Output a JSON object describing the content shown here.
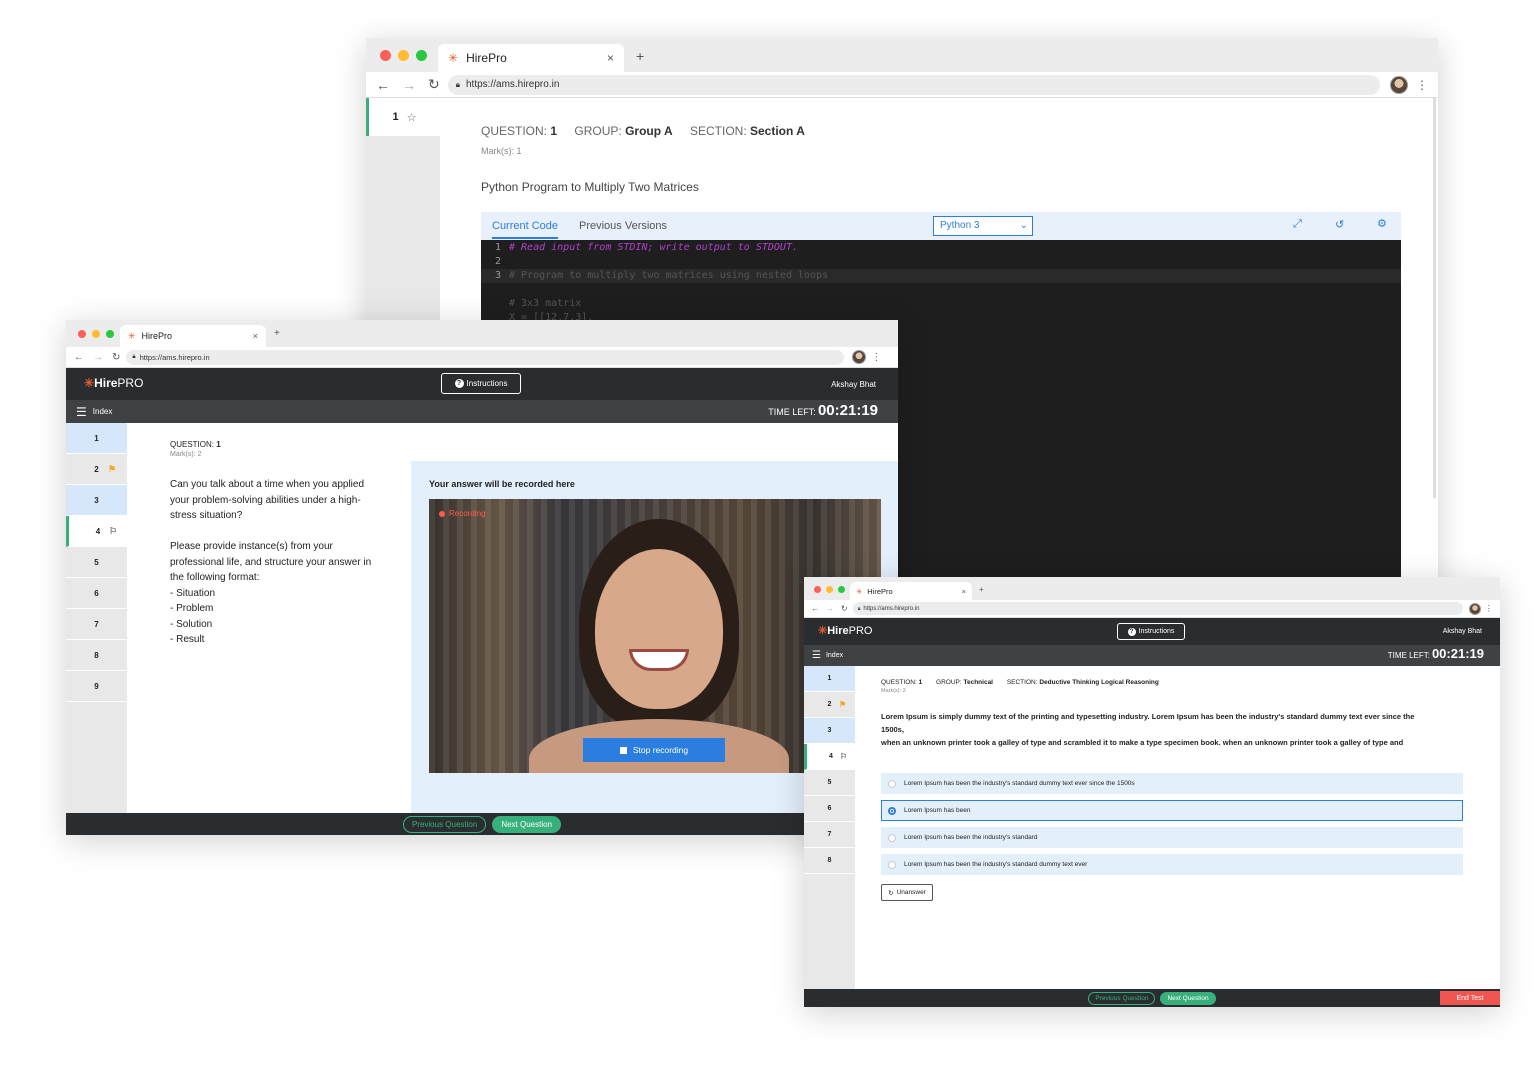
{
  "browser": {
    "tab_title": "HirePro",
    "url": "https://ams.hirepro.in",
    "new_tab": "+",
    "close": "×"
  },
  "back": {
    "sidebar_item": "1",
    "question_label": "QUESTION:",
    "question_num": "1",
    "group_label": "GROUP:",
    "group_val": "Group A",
    "section_label": "SECTION:",
    "section_val": "Section A",
    "marks": "Mark(s):  1",
    "title": "Python Program to Multiply Two Matrices",
    "tabs": [
      "Current Code",
      "Previous Versions"
    ],
    "language": "Python 3",
    "code_lines": [
      {
        "n": "1",
        "text": "# Read input from STDIN; write output to STDOUT."
      },
      {
        "n": "2",
        "text": ""
      },
      {
        "n": "3",
        "text": "# Program to multiply two matrices using nested loops"
      },
      {
        "n": "",
        "text": ""
      },
      {
        "n": "",
        "text": "# 3x3 matrix"
      },
      {
        "n": "",
        "text": "X = [[12,7,3],"
      }
    ]
  },
  "mid": {
    "logo_hire": "Hire",
    "logo_pro": "PRO",
    "instructions": "Instructions",
    "user": "Akshay Bhat",
    "index": "Index",
    "time_label": "TIME LEFT:",
    "time": "00:21:19",
    "question_label": "QUESTION:",
    "question_num": "1",
    "marks": "Mark(s): 2",
    "question_lines": [
      "Can you talk about a time when you applied",
      "your problem-solving abilities under a high-",
      "stress situation?",
      "",
      "Please provide instance(s) from your",
      "professional life, and structure your answer in",
      "the following format:",
      "- Situation",
      "- Problem",
      "- Solution",
      "- Result"
    ],
    "answer_title": "Your answer will be recorded here",
    "recording": "Recording",
    "stop": "Stop recording",
    "prev": "Previous Question",
    "next": "Next Question",
    "items": [
      "1",
      "2",
      "3",
      "4",
      "5",
      "6",
      "7",
      "8",
      "9"
    ]
  },
  "front": {
    "logo_hire": "Hire",
    "logo_pro": "PRO",
    "instructions": "Instructions",
    "user": "Akshay Bhat",
    "index": "Index",
    "time_label": "TIME LEFT:",
    "time": "00:21:19",
    "question_label": "QUESTION:",
    "question_num": "1",
    "group_label": "GROUP:",
    "group_val": "Technical",
    "section_label": "SECTION:",
    "section_val": "Deductive Thinking Logical Reasoning",
    "marks": "Mark(s): 2",
    "question_lines": [
      "Lorem Ipsum is simply dummy text of the printing and typesetting industry. Lorem Ipsum has been the industry's standard dummy text ever since the",
      "1500s,",
      "when an unknown printer took a galley of type and scrambled it to make a type specimen book. when an unknown printer took a galley of type and"
    ],
    "options": [
      "Lorem Ipsum has been the industry's standard dummy text ever since the 1500s",
      "Lorem Ipsum has been",
      "Lorem Ipsum has been the industry's standard",
      "Lorem Ipsum has been the industry's standard dummy text ever"
    ],
    "unanswer": "Unanswer",
    "prev": "Previous Question",
    "next": "Next Question",
    "end": "End Test",
    "items": [
      "1",
      "2",
      "3",
      "4",
      "5",
      "6",
      "7",
      "8"
    ]
  }
}
